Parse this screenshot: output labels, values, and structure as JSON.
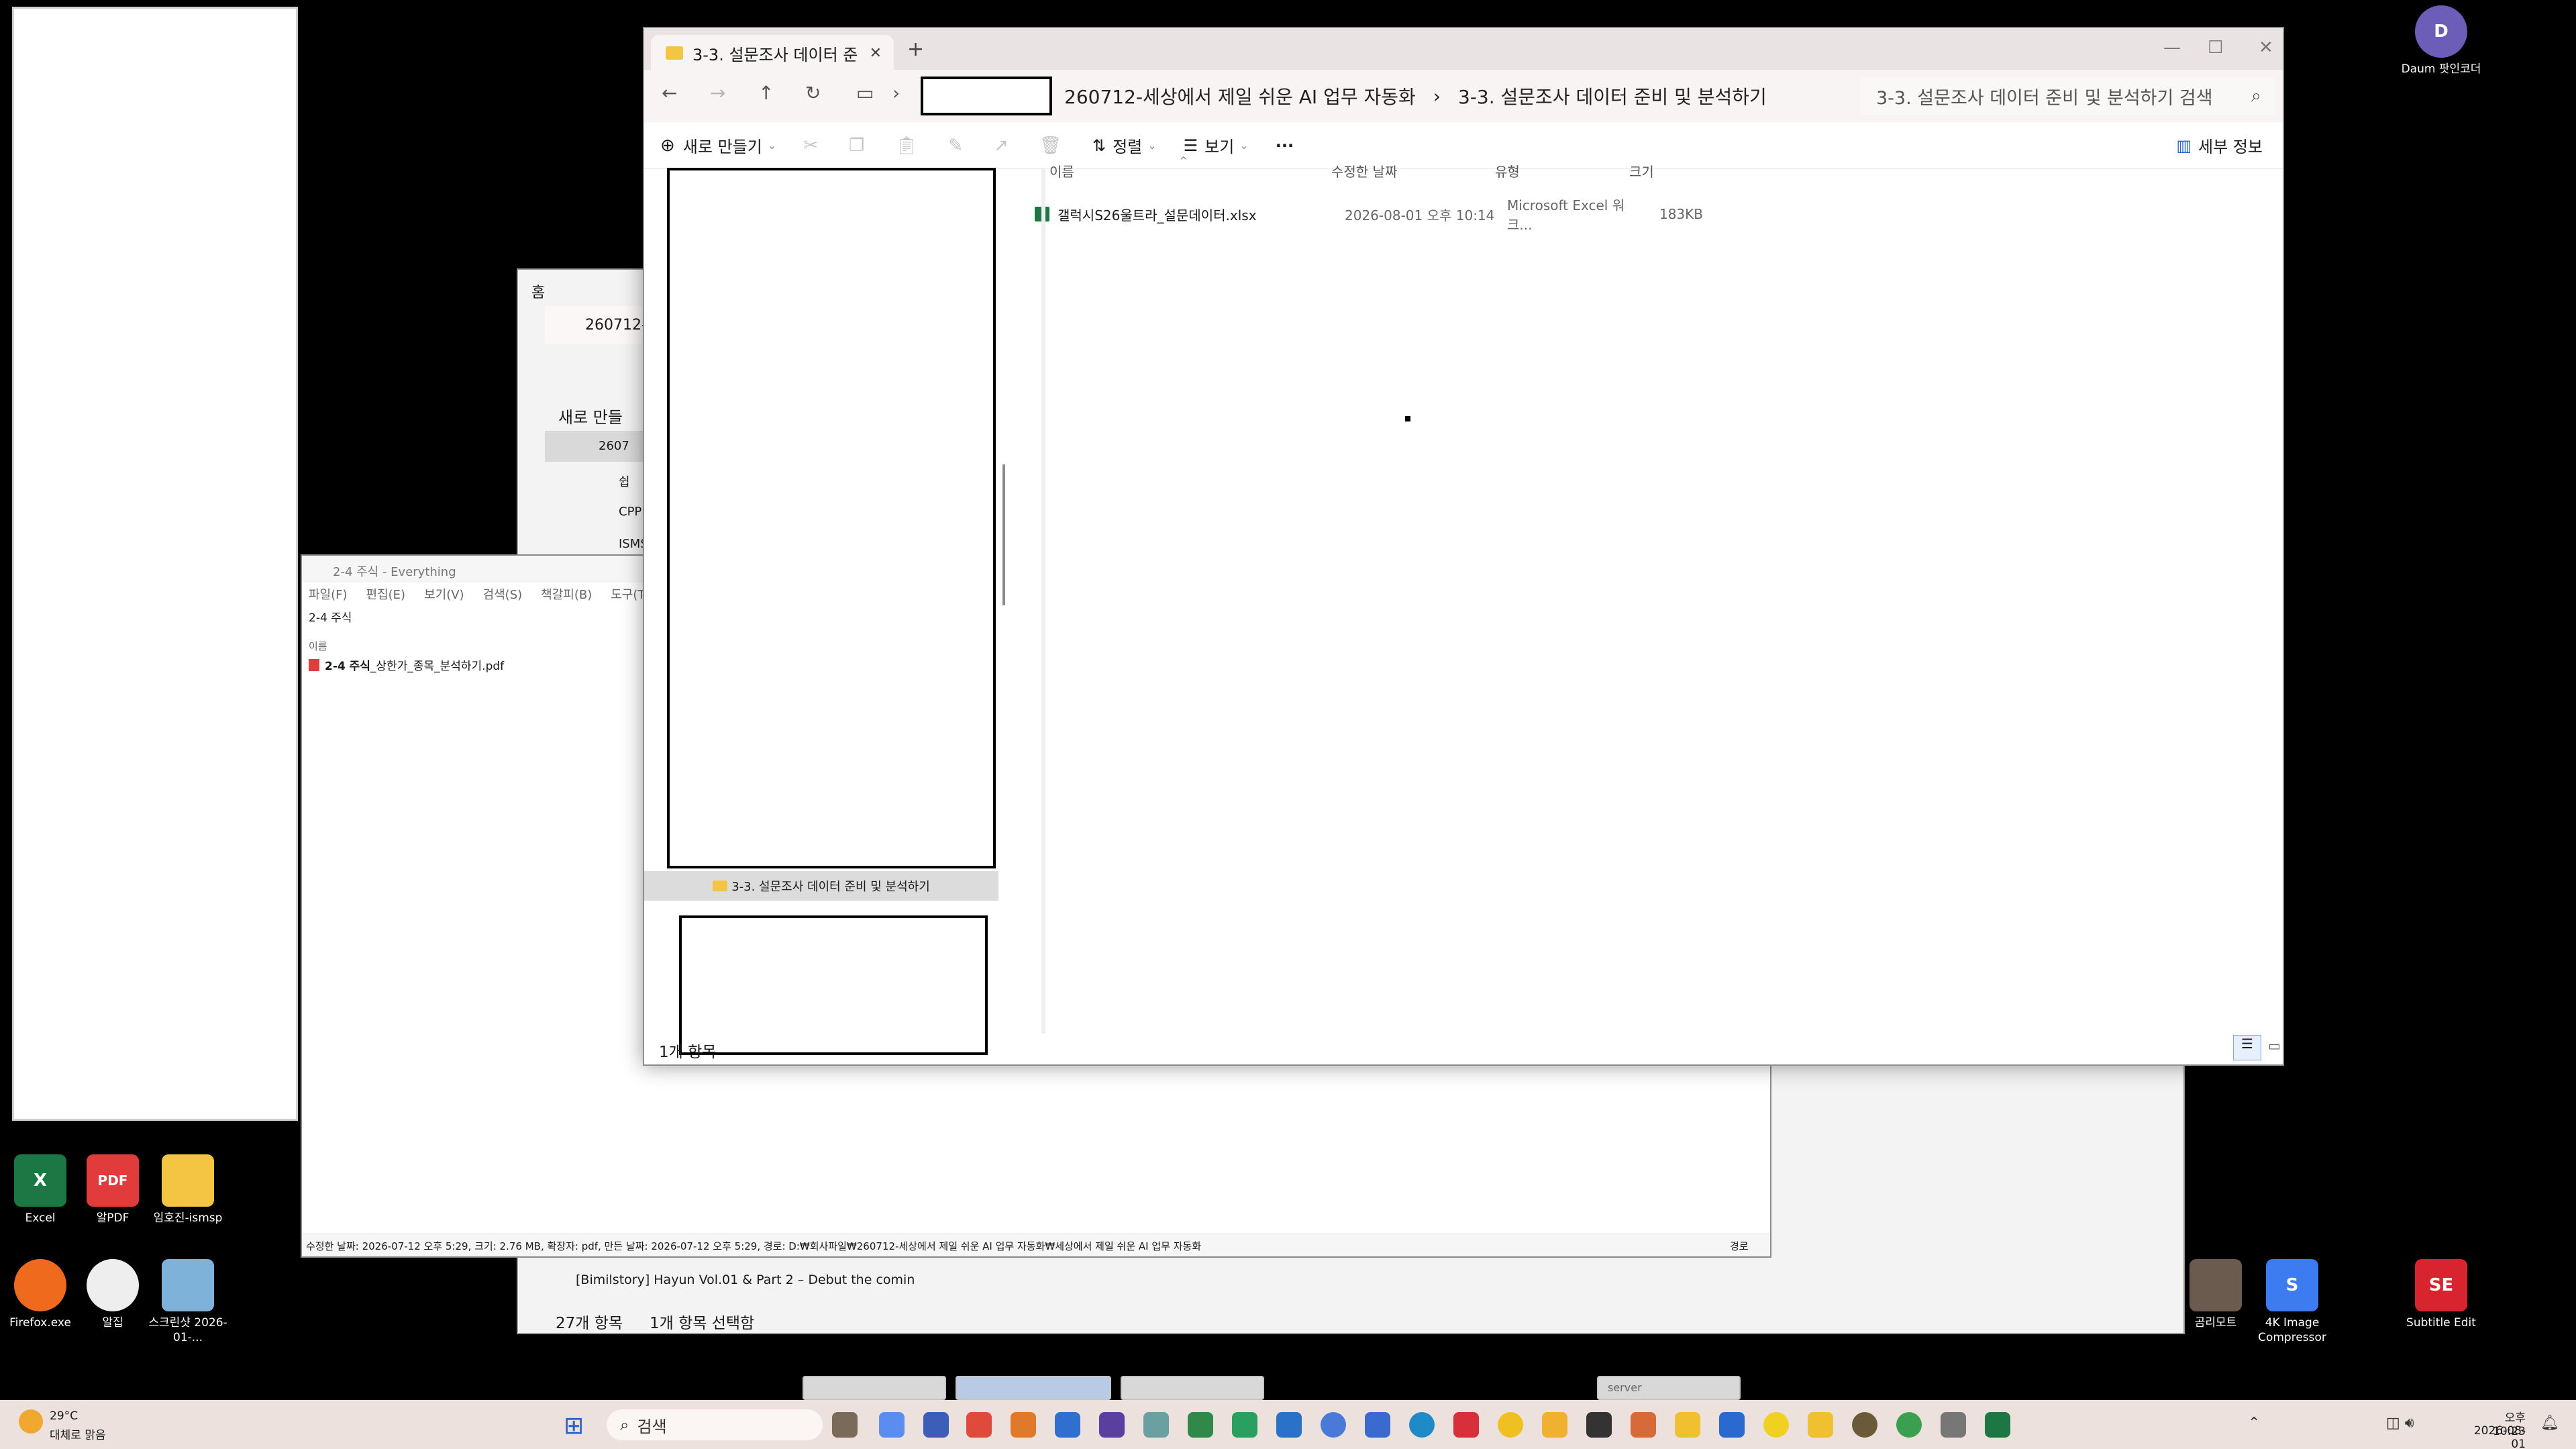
{
  "desktop": {
    "icons": [
      {
        "label": "Excel",
        "color": "#1d7744",
        "glyph": "X"
      },
      {
        "label": "알PDF",
        "color": "#e23b3b",
        "glyph": "PDF"
      },
      {
        "label": "임호진-ismsp",
        "color": "#f4c542",
        "glyph": ""
      },
      {
        "label": "Firefox.exe",
        "color": "#f06a1e",
        "glyph": "●"
      },
      {
        "label": "알집",
        "color": "#eeeeee",
        "glyph": "●"
      },
      {
        "label": "스크린샷 2026-01-...",
        "color": "#7fb2d9",
        "glyph": "▦"
      },
      {
        "label": "Daum 팟인코더",
        "color": "#6b5db8",
        "glyph": "D"
      },
      {
        "label": "곰리모트",
        "color": "#6b5a4e",
        "glyph": "▮"
      },
      {
        "label": "4K Image Compressor",
        "color": "#3d7bf0",
        "glyph": "S"
      },
      {
        "label": "Subtitle Edit",
        "color": "#d9232e",
        "glyph": "SE"
      }
    ]
  },
  "back_explorer": {
    "home_label": "홈",
    "tab_title": "260712-",
    "new_label": "새로 만들",
    "tree": [
      "2607",
      "쉽",
      "CPP",
      "ISMS"
    ],
    "list_item": "[Bimilstory] Hayun Vol.01 & Part 2 – Debut the comin",
    "status_count": "27개 항목",
    "status_selected": "1개 항목 선택함"
  },
  "everything": {
    "title": "2-4 주식 - Everything",
    "menu": [
      "파일(F)",
      "편집(E)",
      "보기(V)",
      "검색(S)",
      "책갈피(B)",
      "도구(T)",
      "도"
    ],
    "query": "2-4 주식",
    "col_name": "이름",
    "result_bold": "2-4 주식",
    "result_rest": "_상한가_종목_분석하기.pdf",
    "statusbar": "수정한 날짜: 2026-07-12 오후 5:29, 크기: 2.76 MB, 확장자: pdf, 만든 날짜: 2026-07-12 오후 5:29, 경로: D:₩회사파일₩260712-세상에서 제일 쉬운 AI 업무 자동화₩세상에서 제일 쉬운 AI 업무 자동화",
    "statusbar_right": "경로"
  },
  "explorer": {
    "tab_title": "3-3. 설문조사 데이터 준",
    "path_segments": [
      "260712-세상에서 제일 쉬운 AI 업무 자동화",
      "3-3. 설문조사 데이터 준비 및 분석하기"
    ],
    "search_placeholder": "3-3. 설문조사 데이터 준비 및 분석하기 검색",
    "toolbar": {
      "new": "새로 만들기",
      "sort": "정렬",
      "view": "보기",
      "more": "···",
      "details": "세부 정보"
    },
    "nav_selected": "3-3. 설문조사 데이터 준비 및 분석하기",
    "columns": {
      "name": "이름",
      "modified": "수정한 날짜",
      "type": "유형",
      "size": "크기"
    },
    "files": [
      {
        "name": "갤럭시S26울트라_설문데이터.xlsx",
        "modified": "2026-08-01 오후 10:14",
        "type": "Microsoft Excel 워크...",
        "size": "183KB"
      }
    ],
    "status_count": "1개 항목"
  },
  "taskbar": {
    "weather_temp": "29°C",
    "weather_desc": "대체로 맑음",
    "search_label": "검색",
    "server_thumb": "server",
    "time": "오후 10:23",
    "date": "2026-08-01"
  }
}
